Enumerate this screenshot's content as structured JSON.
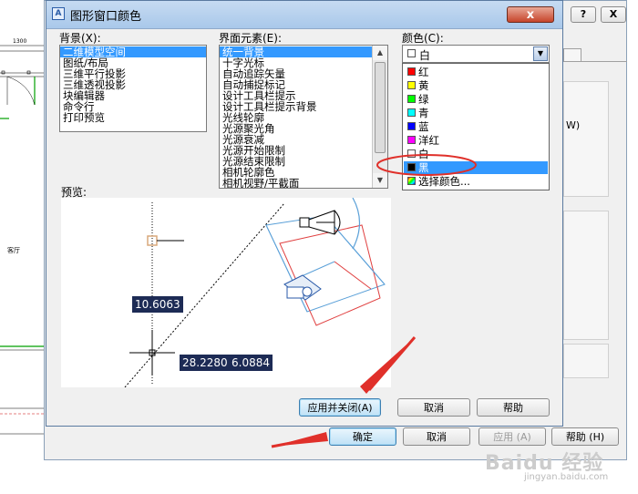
{
  "drawing": {
    "dimension_text": "1300",
    "room_label": "客厅"
  },
  "parent_dialog": {
    "help_icon": "?",
    "close_icon": "X",
    "buttons": {
      "ok": "确定",
      "cancel": "取消",
      "apply": "应用 (A)",
      "help": "帮助 (H)"
    }
  },
  "dialog": {
    "title": "图形窗口颜色",
    "close_label": "x",
    "context_label": "背景(X):",
    "context_items": [
      "二维模型空间",
      "图纸/布局",
      "三维平行投影",
      "三维透视投影",
      "块编辑器",
      "命令行",
      "打印预览"
    ],
    "context_selected": 0,
    "element_label": "界面元素(E):",
    "element_items": [
      "统一背景",
      "十字光标",
      "自动追踪矢量",
      "自动捕捉标记",
      "设计工具栏提示",
      "设计工具栏提示背景",
      "光线轮廓",
      "光源聚光角",
      "光源衰减",
      "光源开始限制",
      "光源结束限制",
      "相机轮廓色",
      "相机视野/平截面"
    ],
    "element_selected": 0,
    "color_label": "颜色(C):",
    "color_value": "白",
    "color_options": [
      {
        "label": "红",
        "color": "#ff0000"
      },
      {
        "label": "黄",
        "color": "#ffff00"
      },
      {
        "label": "绿",
        "color": "#00ff00"
      },
      {
        "label": "青",
        "color": "#00ffff"
      },
      {
        "label": "蓝",
        "color": "#0000ff"
      },
      {
        "label": "洋红",
        "color": "#ff00ff"
      },
      {
        "label": "白",
        "color": "#ffffff"
      },
      {
        "label": "黑",
        "color": "#000000"
      },
      {
        "label": "选择颜色...",
        "color": "palette"
      }
    ],
    "color_highlighted": 7,
    "preview_label": "预览:",
    "preview_values": [
      "10.6063",
      "28.2280",
      "6.0884"
    ],
    "buttons": {
      "apply_close": "应用并关闭(A)",
      "cancel": "取消",
      "help": "帮助"
    }
  },
  "watermark": {
    "brand": "Baidu 经验",
    "url": "jingyan.baidu.com"
  },
  "colors": {
    "selection": "#3399ff",
    "annotation": "#e0302a",
    "coord_box": "#1d2b55"
  }
}
